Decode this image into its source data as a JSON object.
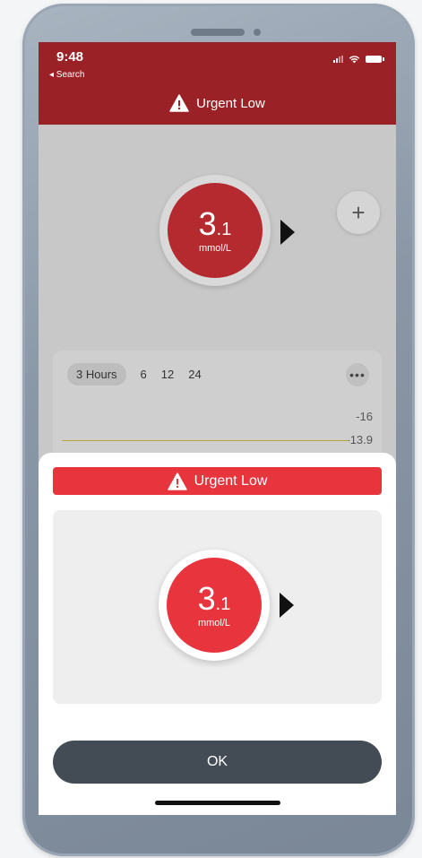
{
  "status_bar": {
    "time": "9:48",
    "back_label": "◂ Search"
  },
  "header": {
    "title": "Urgent Low",
    "icon": "warning-triangle-icon",
    "background_color": "#9a2227"
  },
  "glucose": {
    "value_whole": "3",
    "value_decimal": ".1",
    "unit": "mmol/L",
    "trend_icon": "trend-arrow-right-icon",
    "color": "#e8343d"
  },
  "add_button": {
    "label": "+"
  },
  "graph": {
    "ranges": [
      "3 Hours",
      "6",
      "12",
      "24"
    ],
    "selected_range": "3 Hours",
    "more_label": "•••",
    "axis_values": [
      "16",
      "13.9"
    ]
  },
  "alert_sheet": {
    "banner_title": "Urgent Low",
    "banner_icon": "warning-triangle-icon",
    "banner_color": "#e8343d",
    "glucose_value_whole": "3",
    "glucose_value_decimal": ".1",
    "glucose_unit": "mmol/L",
    "ok_label": "OK"
  }
}
